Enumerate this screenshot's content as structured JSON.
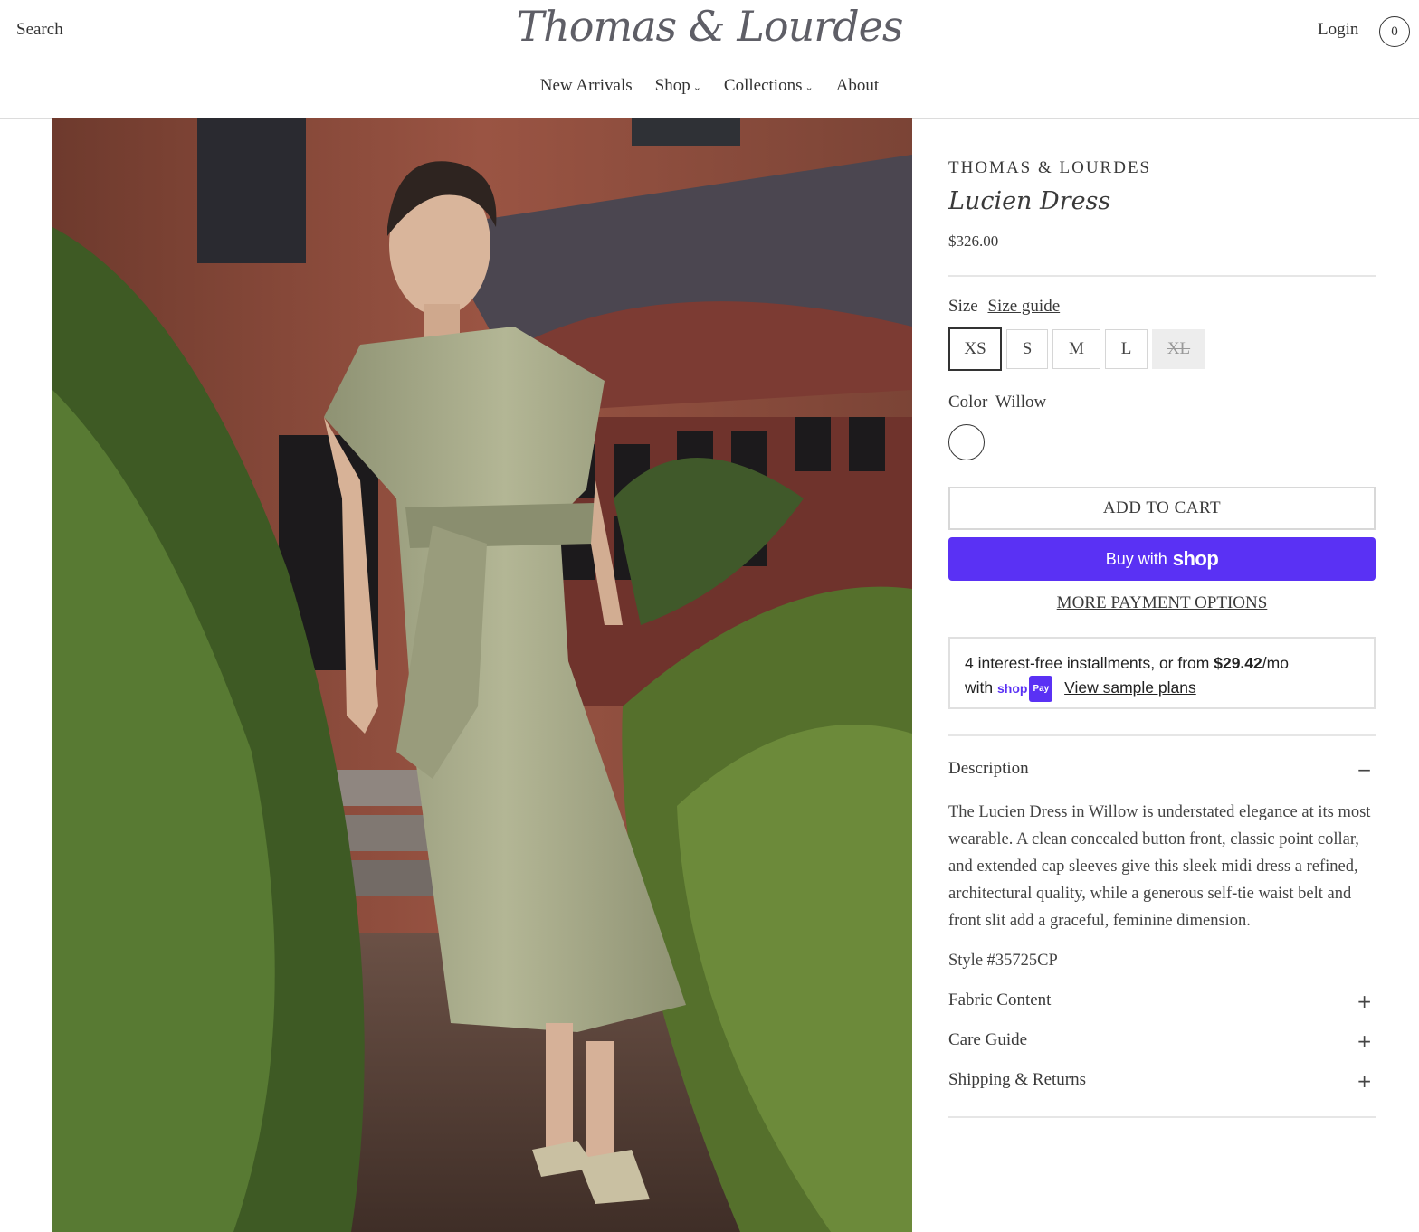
{
  "header": {
    "search_label": "Search",
    "logo_text": "Thomas & Lourdes",
    "login_label": "Login",
    "cart_count": "0",
    "nav": [
      {
        "label": "New Arrivals",
        "has_dropdown": false
      },
      {
        "label": "Shop",
        "has_dropdown": true
      },
      {
        "label": "Collections",
        "has_dropdown": true
      },
      {
        "label": "About",
        "has_dropdown": false
      }
    ]
  },
  "product": {
    "vendor": "THOMAS & LOURDES",
    "title": "Lucien Dress",
    "price": "$326.00",
    "size_label": "Size",
    "size_guide_label": "Size guide",
    "sizes": [
      {
        "label": "XS",
        "state": "selected"
      },
      {
        "label": "S",
        "state": "available"
      },
      {
        "label": "M",
        "state": "available"
      },
      {
        "label": "L",
        "state": "available"
      },
      {
        "label": "XL",
        "state": "sold-out"
      }
    ],
    "color_label": "Color",
    "color_value": "Willow",
    "add_to_cart_label": "ADD TO CART",
    "buy_with_label": "Buy with",
    "shop_word": "shop",
    "more_payment_label": "MORE PAYMENT OPTIONS",
    "installments": {
      "line1_prefix": "4 interest-free installments, or from ",
      "amount": "$29.42",
      "per": "/mo",
      "with_label": "with",
      "shop_mini": "shop",
      "pay_badge": "Pay",
      "view_plans_label": "View sample plans"
    },
    "description_heading": "Description",
    "description_sign": "−",
    "description_text": "The Lucien Dress in Willow is understated elegance at its most wearable. A clean concealed button front, classic point collar, and extended cap sleeves give this sleek midi dress a refined, architectural quality, while a generous self-tie waist belt and front slit add a graceful, feminine dimension.",
    "style_number": "Style #35725CP",
    "accordions": [
      {
        "label": "Fabric Content",
        "sign": "+"
      },
      {
        "label": "Care Guide",
        "sign": "+"
      },
      {
        "label": "Shipping & Returns",
        "sign": "+"
      }
    ]
  },
  "colors": {
    "shop_pay_purple": "#5a31f4",
    "dress": "#a7ab8a",
    "brick": "#8a4a3c",
    "foliage": "#4f6a2e"
  }
}
